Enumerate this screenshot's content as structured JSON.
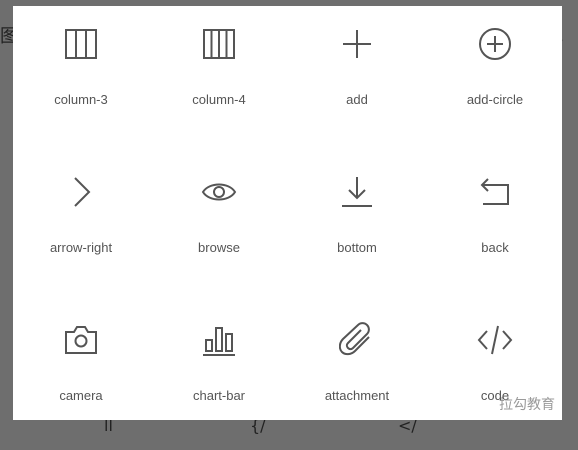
{
  "background": {
    "left_glyph": "图",
    "right_glyph": "。",
    "peek_1": "ll",
    "peek_2": "{/",
    "peek_3": "</"
  },
  "icons": [
    {
      "label": "column-3",
      "icon": "column-3-icon"
    },
    {
      "label": "column-4",
      "icon": "column-4-icon"
    },
    {
      "label": "add",
      "icon": "add-icon"
    },
    {
      "label": "add-circle",
      "icon": "add-circle-icon"
    },
    {
      "label": "arrow-right",
      "icon": "arrow-right-icon"
    },
    {
      "label": "browse",
      "icon": "browse-icon"
    },
    {
      "label": "bottom",
      "icon": "bottom-icon"
    },
    {
      "label": "back",
      "icon": "back-icon"
    },
    {
      "label": "camera",
      "icon": "camera-icon"
    },
    {
      "label": "chart-bar",
      "icon": "chart-bar-icon"
    },
    {
      "label": "attachment",
      "icon": "attachment-icon"
    },
    {
      "label": "code",
      "icon": "code-icon"
    }
  ],
  "watermark": "拉勾教育",
  "colors": {
    "icon_stroke": "#555555",
    "label": "#555555",
    "backdrop": "#6e6e6e",
    "card": "#ffffff",
    "watermark": "#9a9a9a"
  }
}
